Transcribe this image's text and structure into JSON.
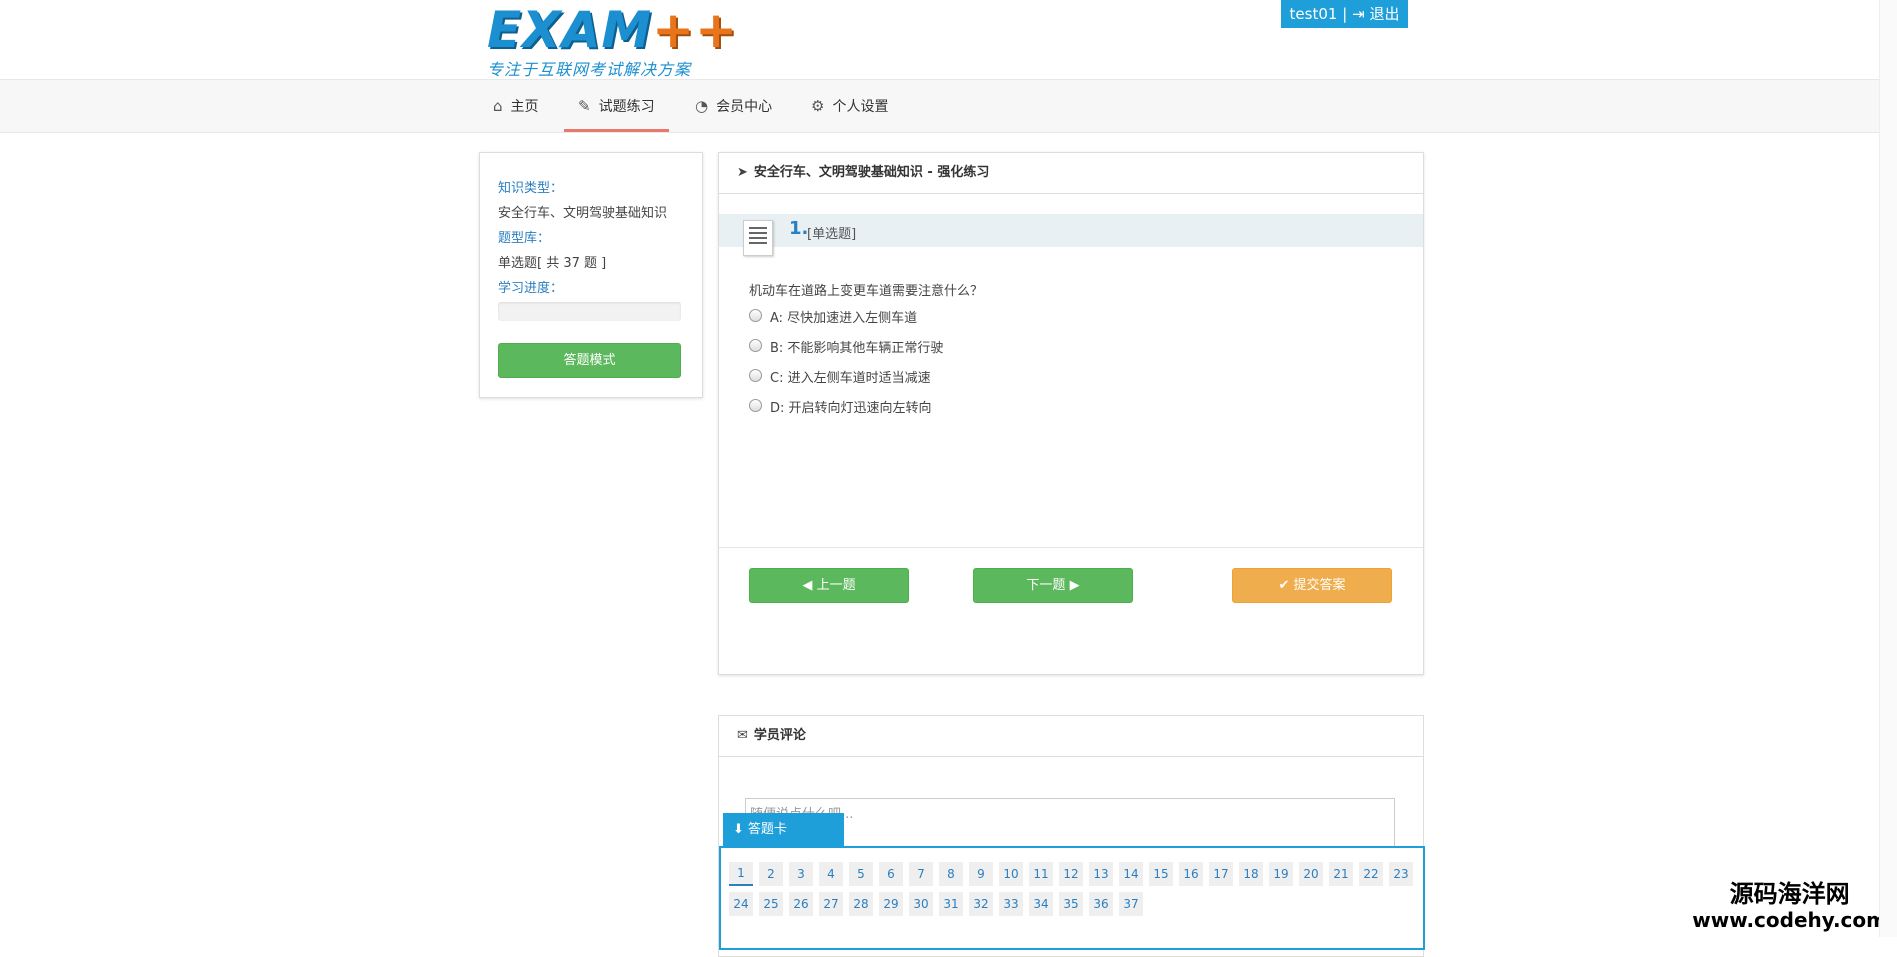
{
  "header": {
    "logo_main": "EXAM",
    "logo_plus": "++",
    "logo_sub": "专注于互联网考试解决方案",
    "username": "test01",
    "separator": "|",
    "logout_label": "退出"
  },
  "nav": {
    "items": [
      {
        "label": "主页",
        "icon": "home-icon"
      },
      {
        "label": "试题练习",
        "icon": "edit-icon",
        "active": true
      },
      {
        "label": "会员中心",
        "icon": "dashboard-icon"
      },
      {
        "label": "个人设置",
        "icon": "gears-icon"
      }
    ]
  },
  "sidebar": {
    "knowledge_type_label": "知识类型：",
    "knowledge_type_value": "安全行车、文明驾驶基础知识",
    "bank_label": "题型库：",
    "bank_value": "单选题[ 共 37 题 ]",
    "progress_label": "学习进度：",
    "progress_fraction": 0,
    "mode_button": "答题模式"
  },
  "question_panel": {
    "title": "安全行车、文明驾驶基础知识 - 强化练习",
    "number": "1.",
    "type": "[单选题]",
    "text": "机动车在道路上变更车道需要注意什么？",
    "options": [
      "A: 尽快加速进入左侧车道",
      "B: 不能影响其他车辆正常行驶",
      "C: 进入左侧车道时适当减速",
      "D: 开启转向灯迅速向左转向"
    ],
    "prev_button": "上一题",
    "next_button": "下一题",
    "submit_button": "提交答案"
  },
  "comments": {
    "title": "学员评论",
    "placeholder": "随便说点什么吧..."
  },
  "answer_card": {
    "title": "答题卡",
    "numbers": [
      "1",
      "2",
      "3",
      "4",
      "5",
      "6",
      "7",
      "8",
      "9",
      "10",
      "11",
      "12",
      "13",
      "14",
      "15",
      "16",
      "17",
      "18",
      "19",
      "20",
      "21",
      "22",
      "23",
      "24",
      "25",
      "26",
      "27",
      "28",
      "29",
      "30",
      "31",
      "32",
      "33",
      "34",
      "35",
      "36",
      "37"
    ],
    "current": "1"
  },
  "watermark": {
    "line1": "源码海洋网",
    "line2": "www.codehy.com"
  },
  "colors": {
    "accent_blue": "#1e9fd9",
    "green": "#5cb85c",
    "orange": "#f0ad4e",
    "nav_active_underline": "#e8786b"
  }
}
